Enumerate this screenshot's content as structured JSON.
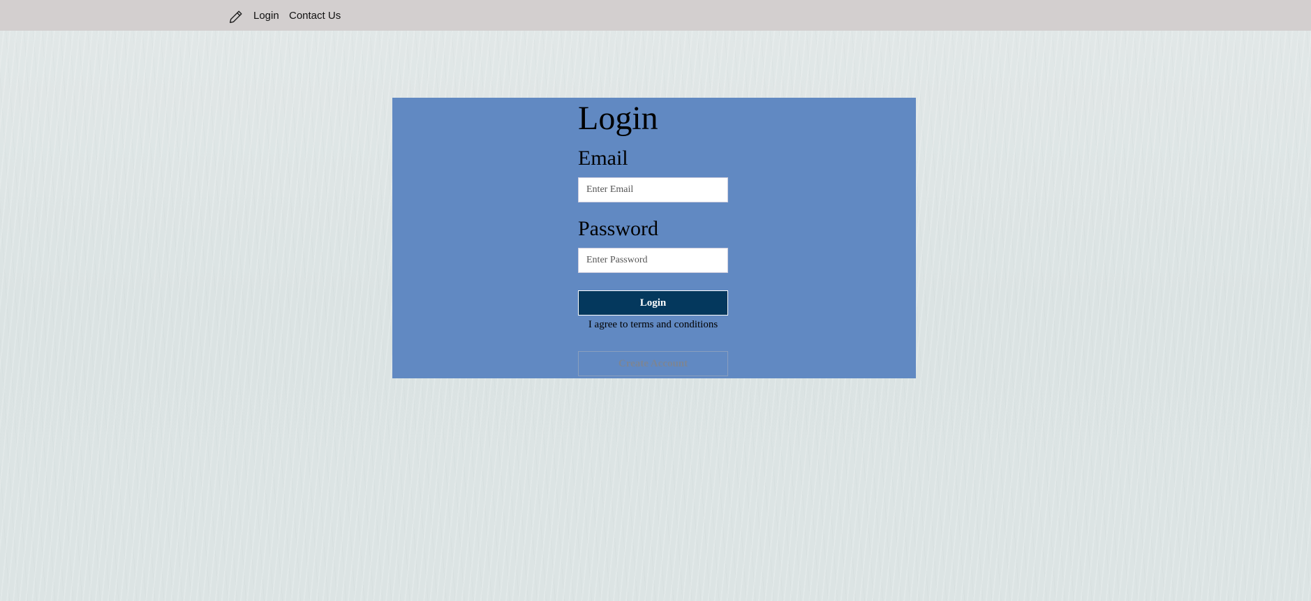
{
  "nav": {
    "brand_icon": "pencil-icon",
    "links": [
      {
        "label": "Login"
      },
      {
        "label": "Contact Us"
      }
    ]
  },
  "form": {
    "title": "Login",
    "email": {
      "label": "Email",
      "placeholder": "Enter Email",
      "value": ""
    },
    "password": {
      "label": "Password",
      "placeholder": "Enter Password",
      "value": ""
    },
    "login_button": "Login",
    "terms_text": "I agree to terms and conditions",
    "create_account_button": "Create Account"
  },
  "colors": {
    "nav_background": "#d3cfcf",
    "card_background": "#6189c2",
    "login_button_background": "#04385d",
    "login_button_text": "#ffffff",
    "page_background": "#dfe6e6"
  }
}
